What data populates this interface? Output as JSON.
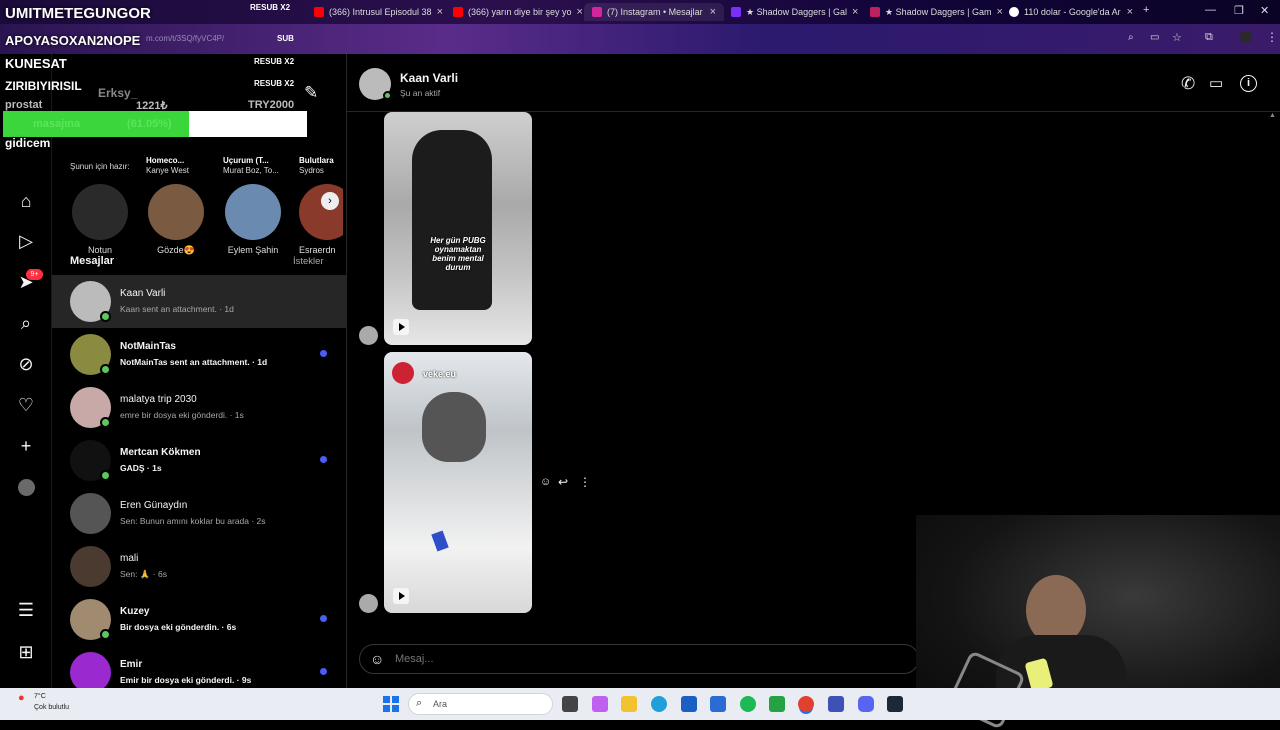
{
  "browser": {
    "tabs": [
      {
        "label": "(366) Intrusul Episodul 38",
        "favicon": "youtube-icon",
        "color": "#ff0000"
      },
      {
        "label": "(366) yarın diye bir şey yo",
        "favicon": "youtube-icon",
        "color": "#ff0000"
      },
      {
        "label": "(7) Instagram • Mesajlar",
        "favicon": "instagram-icon",
        "color": "#d6249f"
      },
      {
        "label": "★ Shadow Daggers | Gal",
        "favicon": "star-icon",
        "color": "#7b2fff"
      },
      {
        "label": "★ Shadow Daggers | Gam",
        "favicon": "star-icon",
        "color": "#c02060"
      },
      {
        "label": "110 dolar - Google'da Ar",
        "favicon": "google-icon",
        "color": "#ffffff"
      }
    ],
    "url_fragment": "m.com/t/3SQ/fyVC4P/"
  },
  "stream_overlay": {
    "title": "UMITMETEGUNGOR",
    "badge1": "RESUB X2",
    "line2": "APOYASOXAN2NOPE",
    "badge2": "SUB",
    "line3": "KUNESAT",
    "badge3": "RESUB X2",
    "line4": "ZIRIBIYIRISIL",
    "badge4": "RESUB X2",
    "user": "Erksy_",
    "line5": "prostat",
    "amount1": "1221₺",
    "amount2": "TRY2000",
    "progress_label": "masajına",
    "progress_text": "(61.05%)",
    "progress": 0.6105,
    "line6": "gidicem"
  },
  "inbox": {
    "notes": [
      {
        "label": "Şunun için hazır:"
      },
      {
        "title": "Homeco...",
        "sub": "Kanye West"
      },
      {
        "title": "Uçurum (T...",
        "sub": "Murat Boz, To..."
      },
      {
        "title": "Bulutlara",
        "sub": "Sydros"
      }
    ],
    "stories": [
      {
        "name": "Notun",
        "color": "#2a2a2a"
      },
      {
        "name": "Gözde😍",
        "color": "#7a5a40"
      },
      {
        "name": "Eylem Şahin",
        "color": "#6a8ab0"
      },
      {
        "name": "Esraerdn",
        "color": "#8a3a2a"
      }
    ],
    "heading": "Mesajlar",
    "requests": "İstekler",
    "threads": [
      {
        "name": "Kaan Varli",
        "preview": "Kaan sent an attachment. · 1d",
        "unread": false,
        "online": true,
        "color": "#bbbbbb"
      },
      {
        "name": "NotMainTas",
        "preview": "NotMainTas sent an attachment. · 1d",
        "unread": true,
        "online": true,
        "color": "#8a8a40"
      },
      {
        "name": "malatya trip 2030",
        "preview": "emre bir dosya eki gönderdi. · 1s",
        "unread": false,
        "online": true,
        "color": "#c9a8a8"
      },
      {
        "name": "Mertcan Kökmen",
        "preview": "GADŞ · 1s",
        "unread": true,
        "online": true,
        "color": "#111111"
      },
      {
        "name": "Eren Günaydın",
        "preview": "Sen: Bunun amını koklar bu arada · 2s",
        "unread": false,
        "online": false,
        "color": "#555555"
      },
      {
        "name": "mali",
        "preview": "Sen: 🙏 · 6s",
        "unread": false,
        "online": false,
        "color": "#4a3a30"
      },
      {
        "name": "Kuzey",
        "preview": "Bir dosya eki gönderdin. · 6s",
        "unread": true,
        "online": true,
        "color": "#a08a70"
      },
      {
        "name": "Emir",
        "preview": "Emir bir dosya eki gönderdi. · 9s",
        "unread": true,
        "online": false,
        "color": "#9a2ad0"
      }
    ]
  },
  "chat": {
    "name": "Kaan Varli",
    "status": "Şu an aktif",
    "media1_caption": "Her gün PUBG oynamaktan benim mental durum",
    "media2_user": "veke.eu",
    "placeholder": "Mesaj..."
  },
  "taskbar": {
    "weather_temp": "7°C",
    "weather_desc": "Çok bulutlu",
    "search": "Ara"
  }
}
